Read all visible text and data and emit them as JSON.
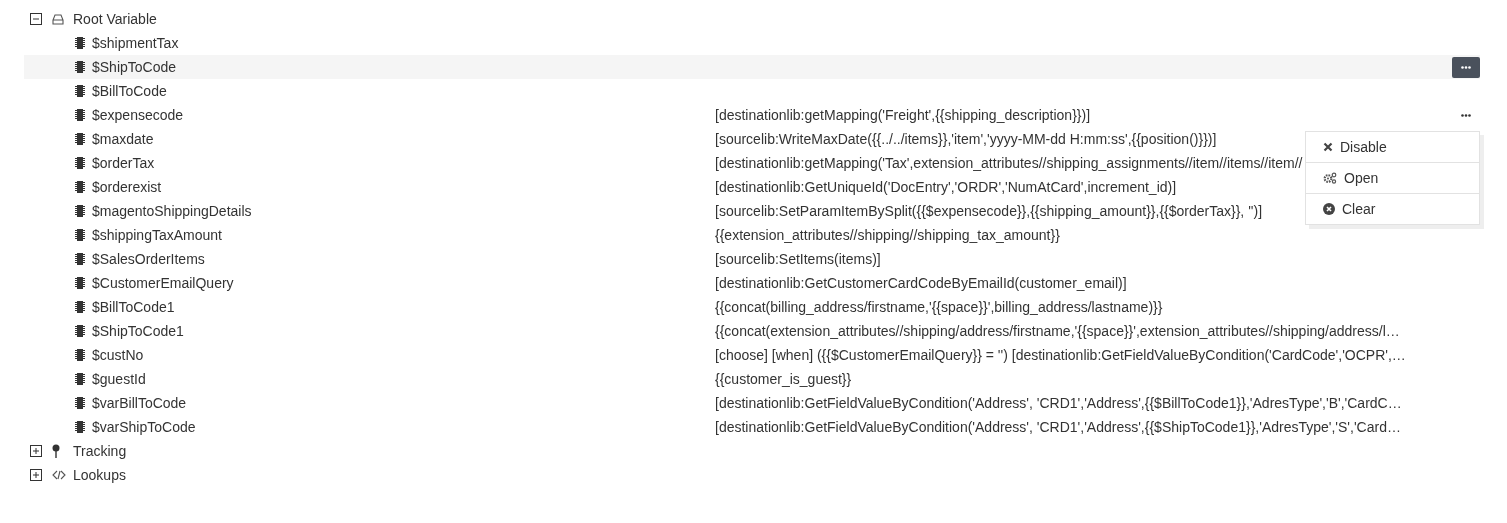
{
  "tree": [
    {
      "label": "Root Variable",
      "expanded": true,
      "children": [
        {
          "name": "$shipmentTax",
          "selected": false
        },
        {
          "name": "$ShipToCode",
          "selected": true,
          "more_button": true
        },
        {
          "name": "$BillToCode",
          "selected": false
        },
        {
          "name": "$expensecode",
          "value": "[destinationlib:getMapping('Freight',{{shipping_description}})]",
          "selected": false,
          "more_button": true
        },
        {
          "name": "$maxdate",
          "value": "[sourcelib:WriteMaxDate({{../../items}},'item','yyyy-MM-dd H:mm:ss',{{position()}})]",
          "selected": false
        },
        {
          "name": "$orderTax",
          "value": "[destinationlib:getMapping('Tax',extension_attributes//shipping_assignments//item//items//item//",
          "selected": false
        },
        {
          "name": "$orderexist",
          "value": "[destinationlib:GetUniqueId('DocEntry','ORDR','NumAtCard',increment_id)]",
          "selected": false
        },
        {
          "name": "$magentoShippingDetails",
          "value": "[sourcelib:SetParamItemBySplit({{$expensecode}},{{shipping_amount}},{{$orderTax}}, '')]",
          "selected": false
        },
        {
          "name": "$shippingTaxAmount",
          "value": "{{extension_attributes//shipping//shipping_tax_amount}}",
          "selected": false
        },
        {
          "name": "$SalesOrderItems",
          "value": "[sourcelib:SetItems(items)]",
          "selected": false
        },
        {
          "name": "$CustomerEmailQuery",
          "value": "[destinationlib:GetCustomerCardCodeByEmailId(customer_email)]",
          "selected": false
        },
        {
          "name": "$BillToCode1",
          "value": "{{concat(billing_address/firstname,'{{space}}',billing_address/lastname)}}",
          "selected": false
        },
        {
          "name": "$ShipToCode1",
          "value": "{{concat(extension_attributes//shipping/address/firstname,'{{space}}',extension_attributes//shipping/address/l…",
          "selected": false
        },
        {
          "name": "$custNo",
          "value": "[choose] [when] ({{$CustomerEmailQuery}} = '') [destinationlib:GetFieldValueByCondition('CardCode','OCPR',…",
          "selected": false
        },
        {
          "name": "$guestId",
          "value": "{{customer_is_guest}}",
          "selected": false
        },
        {
          "name": "$varBillToCode",
          "value": "[destinationlib:GetFieldValueByCondition('Address', 'CRD1','Address',{{$BillToCode1}},'AdresType','B','CardC…",
          "selected": false
        },
        {
          "name": "$varShipToCode",
          "value": "[destinationlib:GetFieldValueByCondition('Address', 'CRD1','Address',{{$ShipToCode1}},'AdresType','S','Card…",
          "selected": false
        }
      ]
    },
    {
      "label": "Tracking",
      "expanded": false
    },
    {
      "label": "Lookups",
      "expanded": false
    }
  ],
  "context_menu": {
    "items": [
      {
        "label": "Disable"
      },
      {
        "label": "Open"
      },
      {
        "label": "Clear"
      }
    ]
  }
}
